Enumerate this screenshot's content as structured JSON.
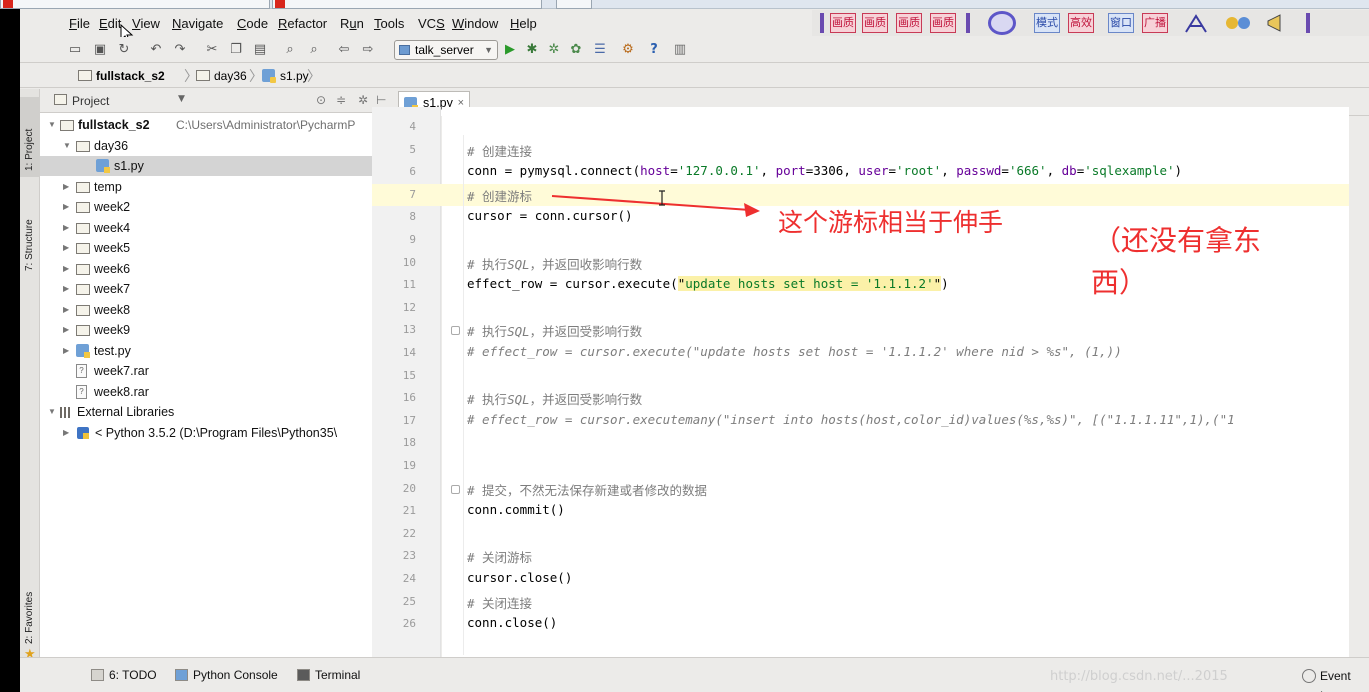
{
  "menu": [
    {
      "label": "File",
      "u": "F"
    },
    {
      "label": "Edit",
      "u": "E"
    },
    {
      "label": "View",
      "u": "V"
    },
    {
      "label": "Navigate",
      "u": "N"
    },
    {
      "label": "Code",
      "u": "C"
    },
    {
      "label": "Refactor",
      "u": "R"
    },
    {
      "label": "Run",
      "u": "u"
    },
    {
      "label": "Tools",
      "u": "T"
    },
    {
      "label": "VCS",
      "u": "S"
    },
    {
      "label": "Window",
      "u": "W"
    },
    {
      "label": "Help",
      "u": "H"
    }
  ],
  "toolbar": {
    "run_config": "talk_server"
  },
  "ad_strip": {
    "buttons": [
      "画质",
      "画质",
      "画质",
      "画质",
      "模式",
      "高效",
      "窗口",
      "广播"
    ]
  },
  "breadcrumb": [
    "fullstack_s2",
    "day36",
    "s1.py"
  ],
  "left_strip": {
    "project_tab": "1: Project",
    "structure_tab": "7: Structure",
    "favorites_tab": "2: Favorites"
  },
  "project_panel": {
    "title": "Project",
    "root_name": "fullstack_s2",
    "root_path": "C:\\Users\\Administrator\\PycharmP",
    "tree": [
      {
        "label": "day36",
        "type": "folder",
        "level": 1,
        "expanded": true
      },
      {
        "label": "s1.py",
        "type": "py",
        "level": 2,
        "selected": true
      },
      {
        "label": "temp",
        "type": "folder",
        "level": 1
      },
      {
        "label": "week2",
        "type": "folder",
        "level": 1
      },
      {
        "label": "week4",
        "type": "folder",
        "level": 1
      },
      {
        "label": "week5",
        "type": "folder",
        "level": 1
      },
      {
        "label": "week6",
        "type": "folder",
        "level": 1
      },
      {
        "label": "week7",
        "type": "folder",
        "level": 1
      },
      {
        "label": "week8",
        "type": "folder",
        "level": 1
      },
      {
        "label": "week9",
        "type": "folder",
        "level": 1
      },
      {
        "label": "test.py",
        "type": "py",
        "level": 1
      },
      {
        "label": "week7.rar",
        "type": "rar",
        "level": 1
      },
      {
        "label": "week8.rar",
        "type": "rar",
        "level": 1
      }
    ],
    "external_libraries": "External Libraries",
    "python_sdk": "< Python 3.5.2 (D:\\Program Files\\Python35\\"
  },
  "editor": {
    "tab_label": "s1.py",
    "current_line": 7,
    "lines": [
      {
        "n": 4,
        "t": ""
      },
      {
        "n": 5,
        "t": "# 创建连接"
      },
      {
        "n": 6,
        "t": "conn = pymysql.connect(host='127.0.0.1', port=3306, user='root', passwd='666', db='sqlexample')"
      },
      {
        "n": 7,
        "t": "# 创建游标"
      },
      {
        "n": 8,
        "t": "cursor = conn.cursor()"
      },
      {
        "n": 9,
        "t": ""
      },
      {
        "n": 10,
        "t": "# 执行SQL，并返回收影响行数"
      },
      {
        "n": 11,
        "t": "effect_row = cursor.execute(\"update hosts set host = '1.1.1.2'\")"
      },
      {
        "n": 12,
        "t": ""
      },
      {
        "n": 13,
        "t": "# 执行SQL，并返回受影响行数"
      },
      {
        "n": 14,
        "t": "# effect_row = cursor.execute(\"update hosts set host = '1.1.1.2' where nid > %s\", (1,))"
      },
      {
        "n": 15,
        "t": ""
      },
      {
        "n": 16,
        "t": "# 执行SQL，并返回受影响行数"
      },
      {
        "n": 17,
        "t": "# effect_row = cursor.executemany(\"insert into hosts(host,color_id)values(%s,%s)\", [(\"1.1.1.11\",1),(\"1"
      },
      {
        "n": 18,
        "t": ""
      },
      {
        "n": 19,
        "t": ""
      },
      {
        "n": 20,
        "t": "# 提交，不然无法保存新建或者修改的数据"
      },
      {
        "n": 21,
        "t": "conn.commit()"
      },
      {
        "n": 22,
        "t": ""
      },
      {
        "n": 23,
        "t": "# 关闭游标"
      },
      {
        "n": 24,
        "t": "cursor.close()"
      },
      {
        "n": 25,
        "t": "# 关闭连接"
      },
      {
        "n": 26,
        "t": "conn.close()"
      }
    ]
  },
  "annotation": {
    "line1": "这个游标相当于伸手",
    "line2a": "（还没有拿东",
    "line2b": "西）",
    "color": "#ee2f2f"
  },
  "bottom_bar": {
    "todo": "6: TODO",
    "python_console": "Python Console",
    "terminal": "Terminal",
    "event_log": "Event Log",
    "watermark": "http://blog.csdn.net/...2015"
  }
}
